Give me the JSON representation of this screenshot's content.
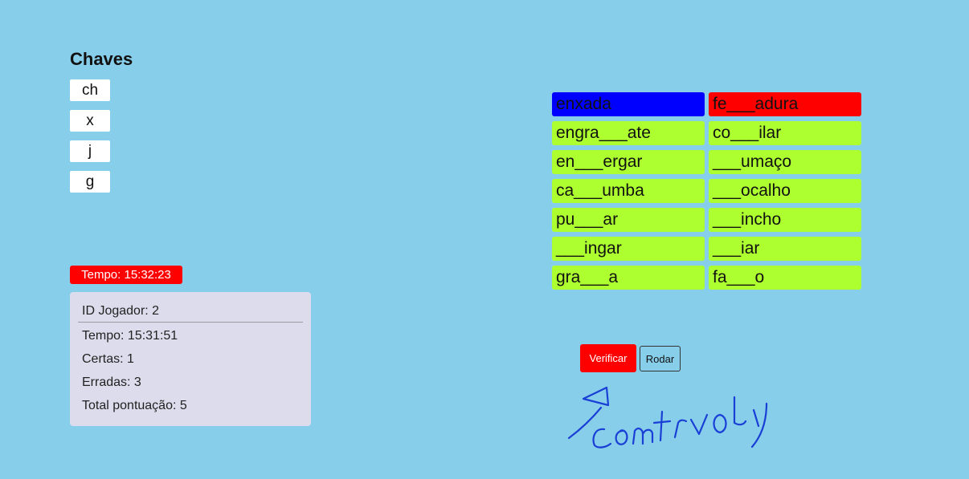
{
  "keys_panel": {
    "title": "Chaves",
    "keys": [
      "ch",
      "x",
      "j",
      "g"
    ]
  },
  "timer": {
    "label": "Tempo: 15:32:23",
    "color": "#ff0000"
  },
  "stats": {
    "player_id": "ID Jogador: 2",
    "time": "Tempo: 15:31:51",
    "correct": "Certas: 1",
    "wrong": "Erradas: 3",
    "total": "Total pontuação: 5"
  },
  "words": {
    "left": [
      "enxada",
      "engra___ate",
      "en___ergar",
      "ca___umba",
      "pu___ar",
      "___ingar",
      "gra___a"
    ],
    "right": [
      "fe___adura",
      "co___ilar",
      "___umaço",
      "___ocalho",
      "___incho",
      "___iar",
      "fa___o"
    ]
  },
  "colors": {
    "background": "#87ceeb",
    "word": "#adff2f",
    "selected": "#0000ff",
    "wrong": "#ff0000"
  },
  "controls": {
    "verify_label": "Verificar",
    "spin_label": "Rodar"
  }
}
